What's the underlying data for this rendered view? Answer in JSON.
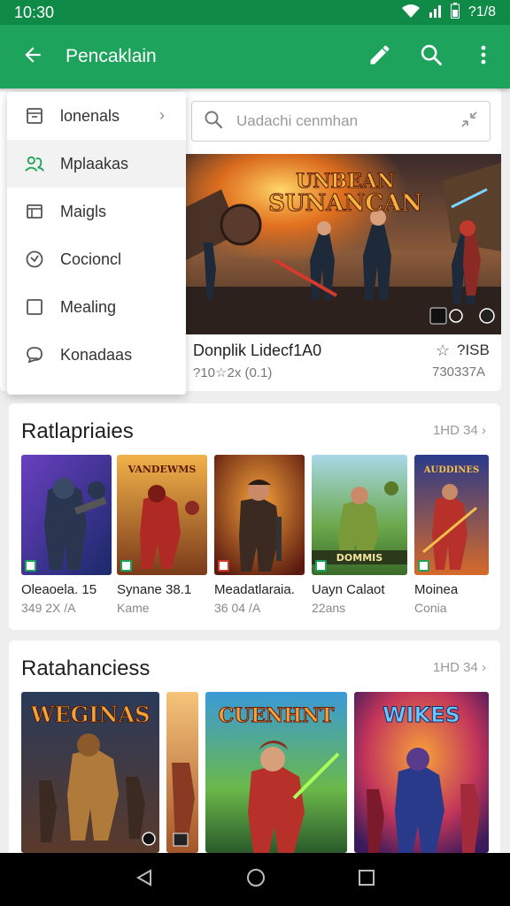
{
  "status_bar": {
    "time": "10:30",
    "right_text": "?1/8"
  },
  "app_bar": {
    "title": "Pencaklain",
    "icons": [
      "back-arrow-icon",
      "pencil-icon",
      "search-icon",
      "more-vert-icon"
    ]
  },
  "menu": {
    "items": [
      {
        "label": "lonenals",
        "icon": "archive-icon",
        "has_chevron": true
      },
      {
        "label": "Mplaakas",
        "icon": "people-icon",
        "active": true
      },
      {
        "label": "Maigls",
        "icon": "tray-icon"
      },
      {
        "label": "Cocioncl",
        "icon": "clock-icon"
      },
      {
        "label": "Mealing",
        "icon": "checkbox-icon"
      },
      {
        "label": "Konadaas",
        "icon": "chat-icon"
      }
    ],
    "chevron": "›"
  },
  "search": {
    "placeholder": "Uadachi cenmhan"
  },
  "featured": {
    "banner_title_line1": "UNBEAN",
    "banner_title_line2": "SUNANCAN",
    "title": "Donplik Lidecf1A0",
    "meta": "?10☆2x (0.1)",
    "right_top": "?ISB",
    "right_bottom": "730337A"
  },
  "section1": {
    "title": "Ratlapriaies",
    "more": "1HD 34 ›",
    "items": [
      {
        "name": "Oleaoela. 15",
        "sub": "349 2X /A"
      },
      {
        "name": "Synane 38.1",
        "sub": "Kame"
      },
      {
        "name": "Meadatlaraia.",
        "sub": "36 04 /A"
      },
      {
        "name": "Uayn Calaot",
        "sub": "22ans"
      },
      {
        "name": "Moinea",
        "sub": "Conia"
      }
    ],
    "art_titles": [
      "",
      "VANDEWMS",
      "",
      "DOMMIS",
      "AUDDINES"
    ]
  },
  "section2": {
    "title": "Ratahanciess",
    "more": "1HD 34 ›",
    "art_titles": [
      "WEGINAS",
      "",
      "CUENHNT",
      "WIKES"
    ]
  },
  "nav": {
    "icons": [
      "back-triangle-icon",
      "home-circle-icon",
      "recents-square-icon"
    ]
  },
  "colors": {
    "primary": "#1da35b",
    "primary_dark": "#0f8a47"
  }
}
